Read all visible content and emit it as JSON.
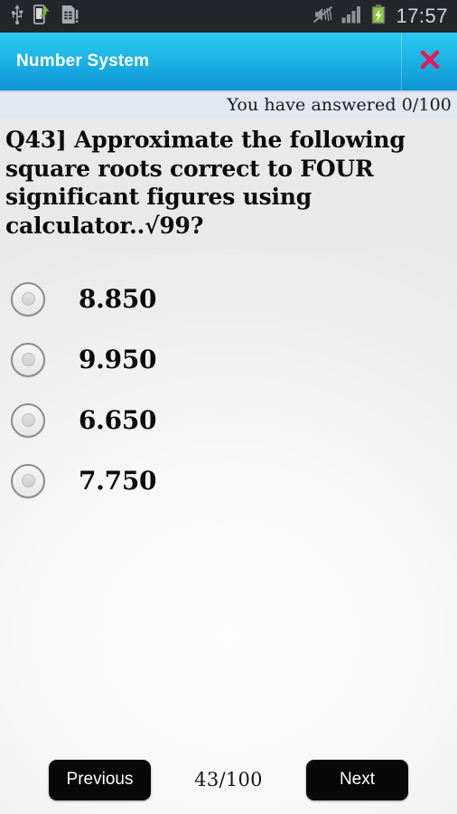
{
  "status_bar": {
    "icons_left": [
      "usb-icon",
      "phone-transfer-icon",
      "sim-card-icon"
    ],
    "icons_right": [
      "vibrate-muted-icon",
      "signal-bars-icon",
      "battery-charging-icon"
    ],
    "time": "17:57",
    "battery_color": "#8dc63f",
    "background": "#23262a"
  },
  "title_bar": {
    "title": "Number System",
    "close_label": "✕",
    "close_color": "#e8185a",
    "gradient_top": "#2bc8f0",
    "gradient_bottom": "#0d93d2"
  },
  "answered": {
    "text": "You have answered 0/100",
    "count": 0,
    "total": 100,
    "background": "#e3e7f1"
  },
  "question": {
    "number_label": "Q43]",
    "text": "Q43]  Approximate the following square roots correct to FOUR significant figures using calculator..√99?"
  },
  "options": [
    {
      "label": "8.850",
      "selected": false
    },
    {
      "label": "9.950",
      "selected": false
    },
    {
      "label": "6.650",
      "selected": false
    },
    {
      "label": "7.750",
      "selected": false
    }
  ],
  "nav": {
    "previous_label": "Previous",
    "next_label": "Next",
    "counter": "43/100",
    "current": 43,
    "total": 100
  }
}
